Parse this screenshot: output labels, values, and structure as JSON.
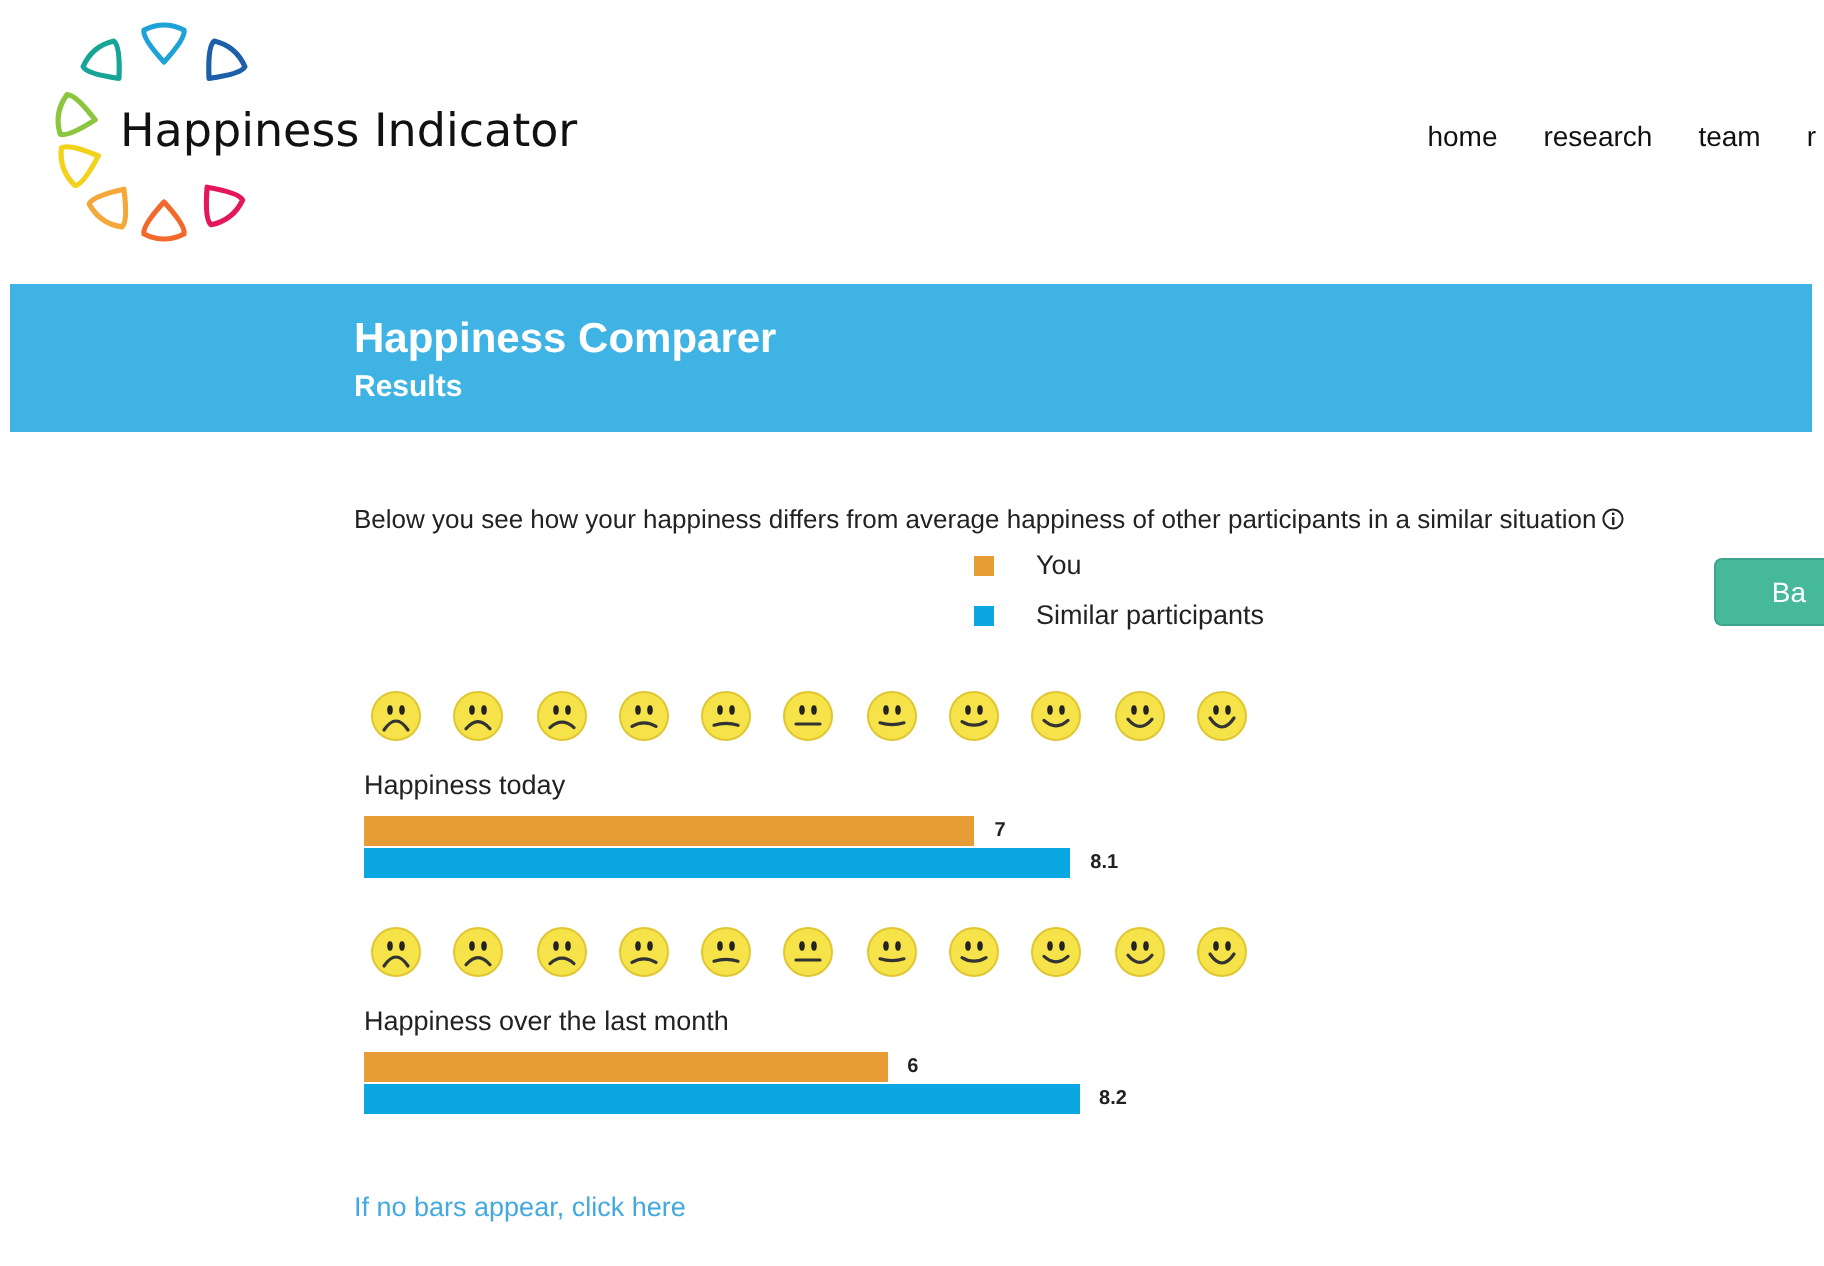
{
  "logo": {
    "text": "Happiness Indicator"
  },
  "nav": [
    {
      "label": "home"
    },
    {
      "label": "research"
    },
    {
      "label": "team"
    },
    {
      "label": "r"
    }
  ],
  "banner": {
    "title": "Happiness Comparer",
    "subtitle": "Results"
  },
  "intro": "Below you see how your happiness differs from average happiness of other participants in a similar situation",
  "button": {
    "label": "Ba"
  },
  "charts": [
    {
      "chart_data": {
        "type": "bar",
        "orientation": "horizontal",
        "title": "Happiness today",
        "data_labels": true,
        "series": [
          {
            "name": "You",
            "color": "#e89c35",
            "values": [
              7
            ]
          },
          {
            "name": "Similar participants",
            "color": "#0aa7e2",
            "values": [
              8.1
            ]
          }
        ]
      }
    },
    {
      "chart_data": {
        "type": "bar",
        "orientation": "horizontal",
        "title": "Happiness over the last month",
        "data_labels": true,
        "series": [
          {
            "color": "#e89c35",
            "values": [
              6
            ]
          },
          {
            "color": "#0aa7e2",
            "values": [
              8.2
            ]
          }
        ]
      }
    }
  ],
  "link": "If no bars appear, click here"
}
